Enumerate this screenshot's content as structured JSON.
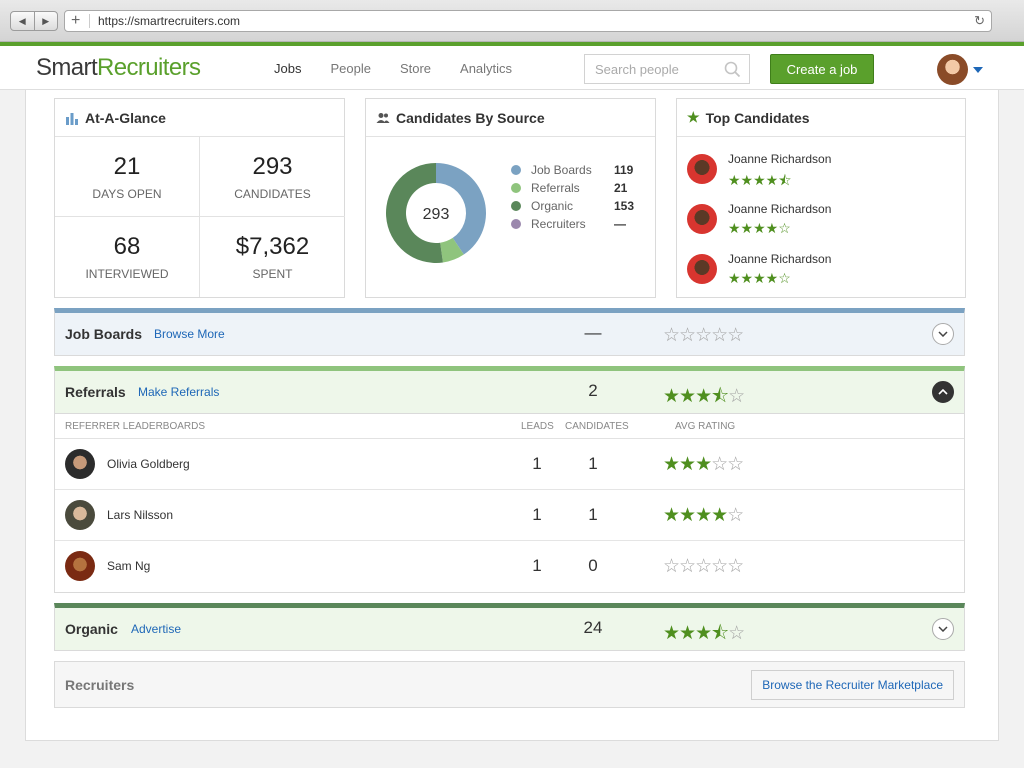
{
  "browser": {
    "url": "https://smartrecruiters.com"
  },
  "header": {
    "logo_part1": "Smart",
    "logo_part2": "Recruiters",
    "nav": [
      "Jobs",
      "People",
      "Store",
      "Analytics"
    ],
    "active_nav": "Jobs",
    "search_placeholder": "Search people",
    "create_label": "Create a job"
  },
  "glance": {
    "title": "At-A-Glance",
    "stats": [
      {
        "value": "21",
        "label": "DAYS OPEN"
      },
      {
        "value": "293",
        "label": "CANDIDATES"
      },
      {
        "value": "68",
        "label": "INTERVIEWED"
      },
      {
        "value": "$7,362",
        "label": "SPENT"
      }
    ]
  },
  "source": {
    "title": "Candidates By Source",
    "total": "293",
    "legend": [
      {
        "name": "Job Boards",
        "value": "119",
        "color": "#7ba2c2"
      },
      {
        "name": "Referrals",
        "value": "21",
        "color": "#8fc47d"
      },
      {
        "name": "Organic",
        "value": "153",
        "color": "#5a875a"
      },
      {
        "name": "Recruiters",
        "value": "—",
        "color": "#9b88ad"
      }
    ]
  },
  "top_candidates": {
    "title": "Top Candidates",
    "items": [
      {
        "name": "Joanne Richardson",
        "stars": "★★★★⯪"
      },
      {
        "name": "Joanne Richardson",
        "stars": "★★★★☆"
      },
      {
        "name": "Joanne Richardson",
        "stars": "★★★★☆"
      }
    ]
  },
  "job_boards": {
    "title": "Job Boards",
    "link": "Browse More",
    "count": "—",
    "stars_on": "",
    "stars_off": "☆☆☆☆☆",
    "accent": "#7ba2c2"
  },
  "referrals": {
    "title": "Referrals",
    "link": "Make Referrals",
    "count": "2",
    "stars_on": "★★★⯪",
    "stars_off": "☆",
    "accent": "#8fc47d",
    "table_headers": {
      "name": "REFERRER LEADERBOARDS",
      "leads": "LEADS",
      "candidates": "CANDIDATES",
      "rating": "AVG RATING"
    },
    "rows": [
      {
        "name": "Olivia Goldberg",
        "leads": "1",
        "candidates": "1",
        "stars_on": "★★★",
        "stars_off": "☆☆"
      },
      {
        "name": "Lars Nilsson",
        "leads": "1",
        "candidates": "1",
        "stars_on": "★★★★",
        "stars_off": "☆"
      },
      {
        "name": "Sam Ng",
        "leads": "1",
        "candidates": "0",
        "stars_on": "",
        "stars_off": "☆☆☆☆☆"
      }
    ]
  },
  "organic": {
    "title": "Organic",
    "link": "Advertise",
    "count": "24",
    "stars_on": "★★★⯪",
    "stars_off": "☆",
    "accent": "#5a875a"
  },
  "recruiters": {
    "title": "Recruiters",
    "button": "Browse the Recruiter Marketplace"
  }
}
